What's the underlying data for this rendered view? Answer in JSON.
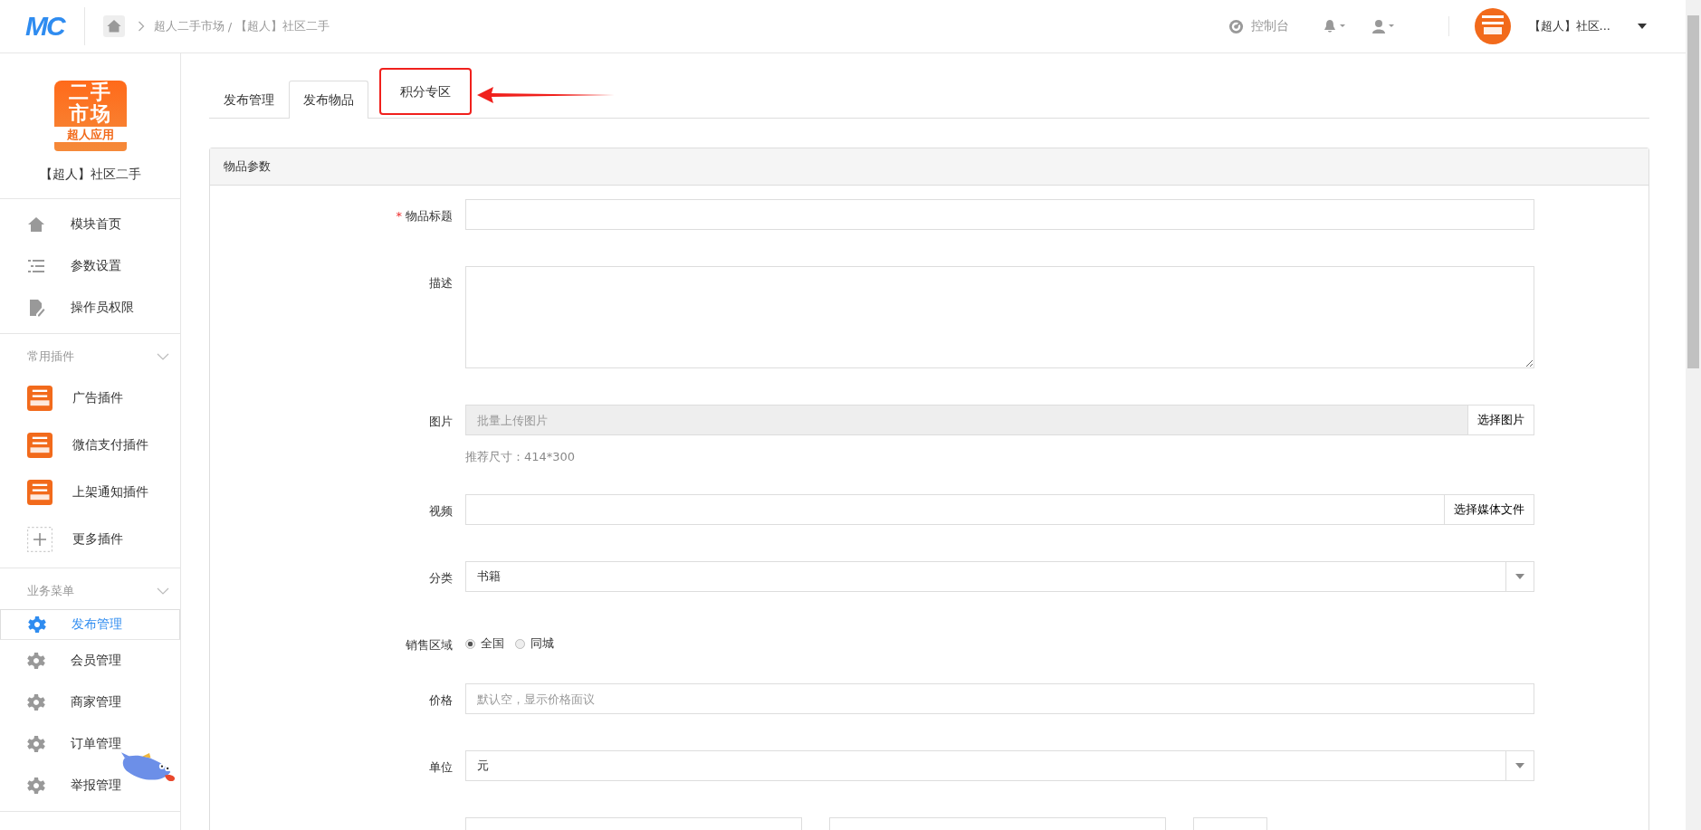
{
  "header": {
    "logo": "MC",
    "breadcrumb": [
      "超人二手市场",
      "【超人】社区二手"
    ],
    "breadcrumb_separator": "/",
    "console": "控制台",
    "account": "【超人】社区..."
  },
  "sidebar": {
    "app_logo": {
      "line1": "二手",
      "line2": "市场",
      "caption": "超人应用"
    },
    "app_name": "【超人】社区二手",
    "main_items": [
      {
        "label": "模块首页",
        "kind": "home",
        "selected": false
      },
      {
        "label": "参数设置",
        "kind": "list",
        "selected": false
      },
      {
        "label": "操作员权限",
        "kind": "doc",
        "selected": false
      }
    ],
    "sections": [
      {
        "title": "常用插件",
        "expanded": true,
        "items": [
          {
            "label": "广告插件",
            "kind": "plugin",
            "selected": false
          },
          {
            "label": "微信支付插件",
            "kind": "plugin",
            "selected": false
          },
          {
            "label": "上架通知插件",
            "kind": "plugin",
            "selected": false
          },
          {
            "label": "更多插件",
            "kind": "add",
            "selected": false
          }
        ]
      },
      {
        "title": "业务菜单",
        "expanded": true,
        "items": [
          {
            "label": "发布管理",
            "kind": "gear",
            "selected": true
          },
          {
            "label": "会员管理",
            "kind": "gear",
            "selected": false
          },
          {
            "label": "商家管理",
            "kind": "gear",
            "selected": false
          },
          {
            "label": "订单管理",
            "kind": "gear",
            "selected": false
          },
          {
            "label": "举报管理",
            "kind": "gear",
            "selected": false
          }
        ]
      }
    ]
  },
  "tabs": [
    {
      "label": "发布管理",
      "selected": false,
      "highlighted": false
    },
    {
      "label": "发布物品",
      "selected": true,
      "highlighted": false
    },
    {
      "label": "积分专区",
      "selected": false,
      "highlighted": true
    }
  ],
  "panel": {
    "title": "物品参数",
    "required_mark": "*",
    "fields": [
      {
        "kind": "text",
        "label": "物品标题",
        "required": true
      },
      {
        "kind": "textarea",
        "label": "描述"
      },
      {
        "kind": "upload",
        "label": "图片",
        "disabled": true,
        "placeholder": "批量上传图片",
        "button": "选择图片",
        "hint": "推荐尺寸：414*300"
      },
      {
        "kind": "upload",
        "label": "视频",
        "disabled": false,
        "button": "选择媒体文件"
      },
      {
        "kind": "select",
        "label": "分类",
        "value": "书籍"
      },
      {
        "kind": "radio",
        "label": "销售区域",
        "options": [
          {
            "label": "全国",
            "selected": true
          },
          {
            "label": "同城",
            "selected": false
          }
        ]
      },
      {
        "kind": "text",
        "label": "价格",
        "placeholder": "默认空，显示价格面议"
      },
      {
        "kind": "select",
        "label": "单位",
        "value": "元"
      },
      {
        "kind": "partial"
      }
    ]
  }
}
